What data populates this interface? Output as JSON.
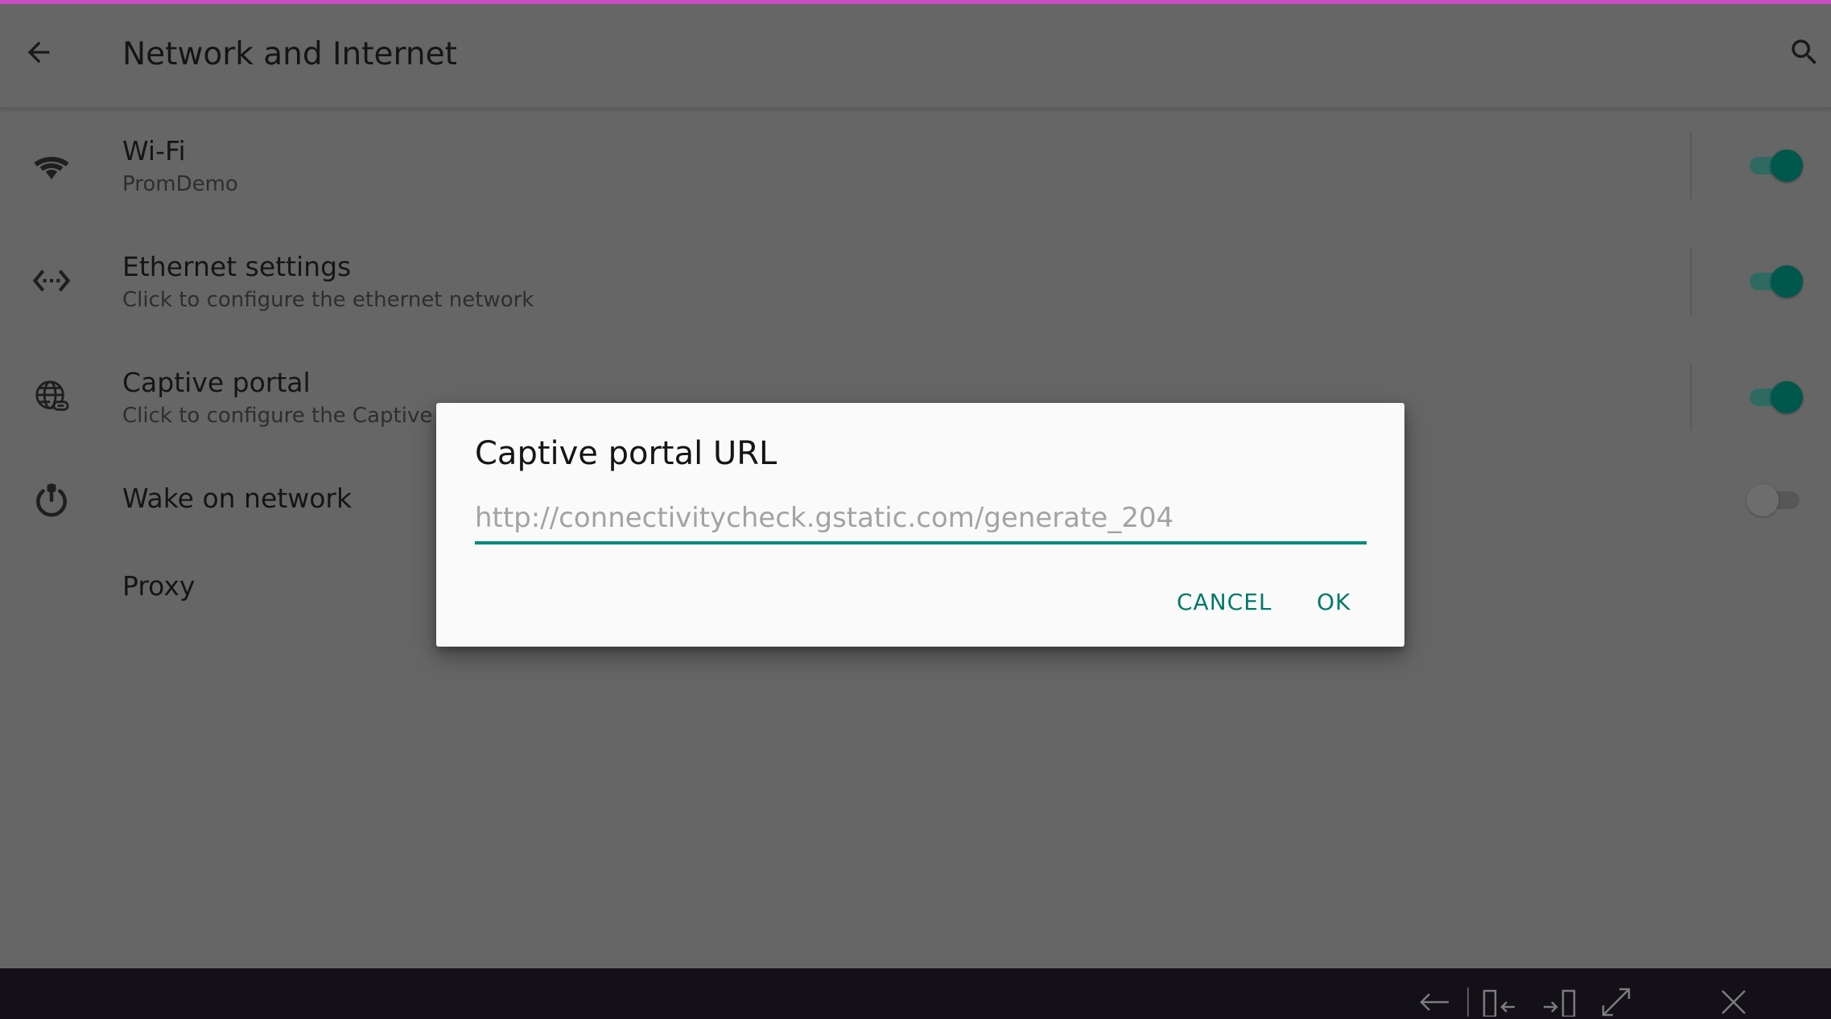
{
  "app": {
    "title": "Network and Internet",
    "accent_color": "#00897b",
    "top_line_color": "#c84fc1"
  },
  "appbar": {
    "back_icon": "arrow-back-icon",
    "search_icon": "search-icon"
  },
  "preferences": [
    {
      "icon": "wifi-icon",
      "title": "Wi-Fi",
      "summary": "PromDemo",
      "switch": "on"
    },
    {
      "icon": "ethernet-icon",
      "title": "Ethernet settings",
      "summary": "Click to configure the ethernet network",
      "switch": "on"
    },
    {
      "icon": "globe-link-icon",
      "title": "Captive portal",
      "summary": "Click to configure the Captive po",
      "switch": "on"
    },
    {
      "icon": "power-icon",
      "title": "Wake on network",
      "summary": "",
      "switch": "off"
    },
    {
      "icon": "",
      "title": "Proxy",
      "summary": "",
      "switch": ""
    }
  ],
  "dialog": {
    "title": "Captive portal URL",
    "input_placeholder": "http://connectivitycheck.gstatic.com/generate_204",
    "input_value": "",
    "cancel_label": "CANCEL",
    "ok_label": "OK"
  },
  "navbar": {
    "icons": [
      "arrow-left-icon",
      "dock-left-icon",
      "dock-right-icon",
      "expand-icon",
      "close-icon"
    ]
  }
}
